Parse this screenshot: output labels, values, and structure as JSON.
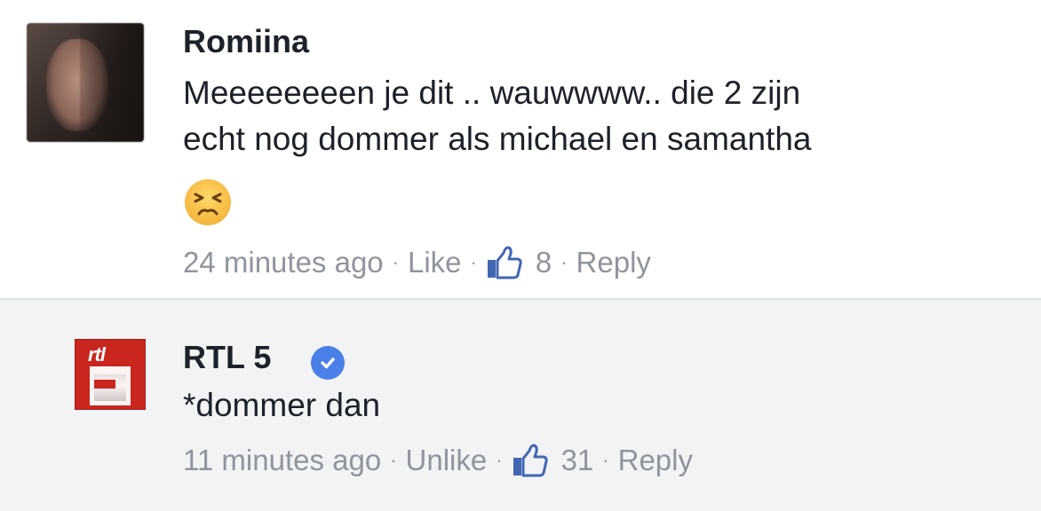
{
  "comments": [
    {
      "author": "Romiina",
      "text_line1": "Meeeeeeeen je dit .. wauwwww.. die 2 zijn",
      "text_line2": "echt nog dommer als michael en samantha",
      "emoji": "persevering-face-emoji",
      "time": "24 minutes ago",
      "like_label": "Like",
      "like_count": "8",
      "reply_label": "Reply"
    },
    {
      "author": "RTL 5",
      "verified": true,
      "text": "*dommer dan",
      "time": "11 minutes ago",
      "like_label": "Unlike",
      "like_count": "31",
      "reply_label": "Reply",
      "avatar_logo_text": "rtl"
    }
  ],
  "separator": "·",
  "colors": {
    "meta_text": "#90949c",
    "thumb_blue": "#4267b2",
    "verified_blue": "#4a80e8",
    "reply_background": "#f2f3f5",
    "rtl_red": "#c8261f"
  }
}
